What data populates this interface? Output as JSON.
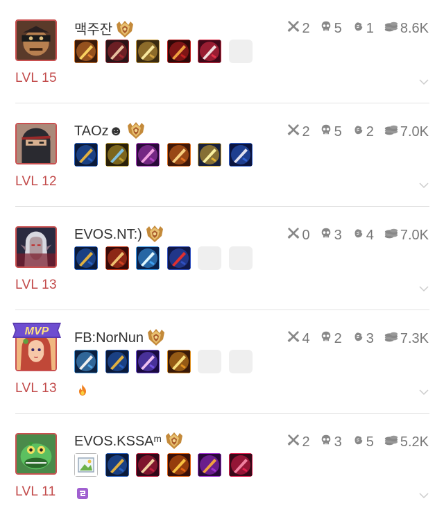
{
  "players": [
    {
      "name": "맥주잔",
      "level": "LVL 15",
      "kills": "2",
      "deaths": "5",
      "assists": "1",
      "gold": "8.6K",
      "mvp": false,
      "badge": null,
      "hero_icon": "masked-bandit-hero-avatar",
      "items": [
        "crossbow-item-icon",
        "red-boots-item-icon",
        "golden-sword-item-icon",
        "red-blade-item-icon",
        "crimson-scythe-item-icon",
        "empty"
      ]
    },
    {
      "name": "TAOz☻",
      "level": "LVL 12",
      "kills": "2",
      "deaths": "5",
      "assists": "2",
      "gold": "7.0K",
      "mvp": false,
      "badge": null,
      "hero_icon": "masked-ninja-hero-avatar",
      "items": [
        "blue-boots-item-icon",
        "dagger-item-icon",
        "purple-staff-item-icon",
        "orange-shield-item-icon",
        "gold-blade-item-icon",
        "sword-item-icon"
      ]
    },
    {
      "name": "EVOS.NT:)",
      "level": "LVL 13",
      "kills": "0",
      "deaths": "3",
      "assists": "4",
      "gold": "7.0K",
      "mvp": false,
      "badge": null,
      "hero_icon": "dark-elf-hero-avatar",
      "items": [
        "blue-boots-item-icon",
        "red-spear-item-icon",
        "ice-orb-item-icon",
        "blue-armor-item-icon",
        "empty",
        "empty"
      ]
    },
    {
      "name": "FB:NorNun",
      "level": "LVL 13",
      "kills": "4",
      "deaths": "2",
      "assists": "3",
      "gold": "7.3K",
      "mvp": true,
      "mvp_label": "MVP",
      "badge": "fire-badge-icon",
      "hero_icon": "red-hair-heroine-avatar",
      "items": [
        "potion-item-icon",
        "blue-boots-item-icon",
        "magic-wings-item-icon",
        "golden-crown-item-icon",
        "empty",
        "empty"
      ]
    },
    {
      "name": "EVOS.KSSAᵐ",
      "level": "LVL 11",
      "kills": "2",
      "deaths": "3",
      "assists": "5",
      "gold": "5.2K",
      "mvp": false,
      "badge": "purple-emblem-badge-icon",
      "hero_icon": "green-lizard-hero-avatar",
      "items": [
        "broken-image-item-icon",
        "blue-boots-item-icon",
        "crimson-boots-item-icon",
        "fire-ring-item-icon",
        "purple-helm-item-icon",
        "ruby-wand-item-icon"
      ]
    }
  ],
  "colors": {
    "level_red": "#c24a4a",
    "stat_gray": "#777777",
    "divider": "#e2e2e2"
  }
}
